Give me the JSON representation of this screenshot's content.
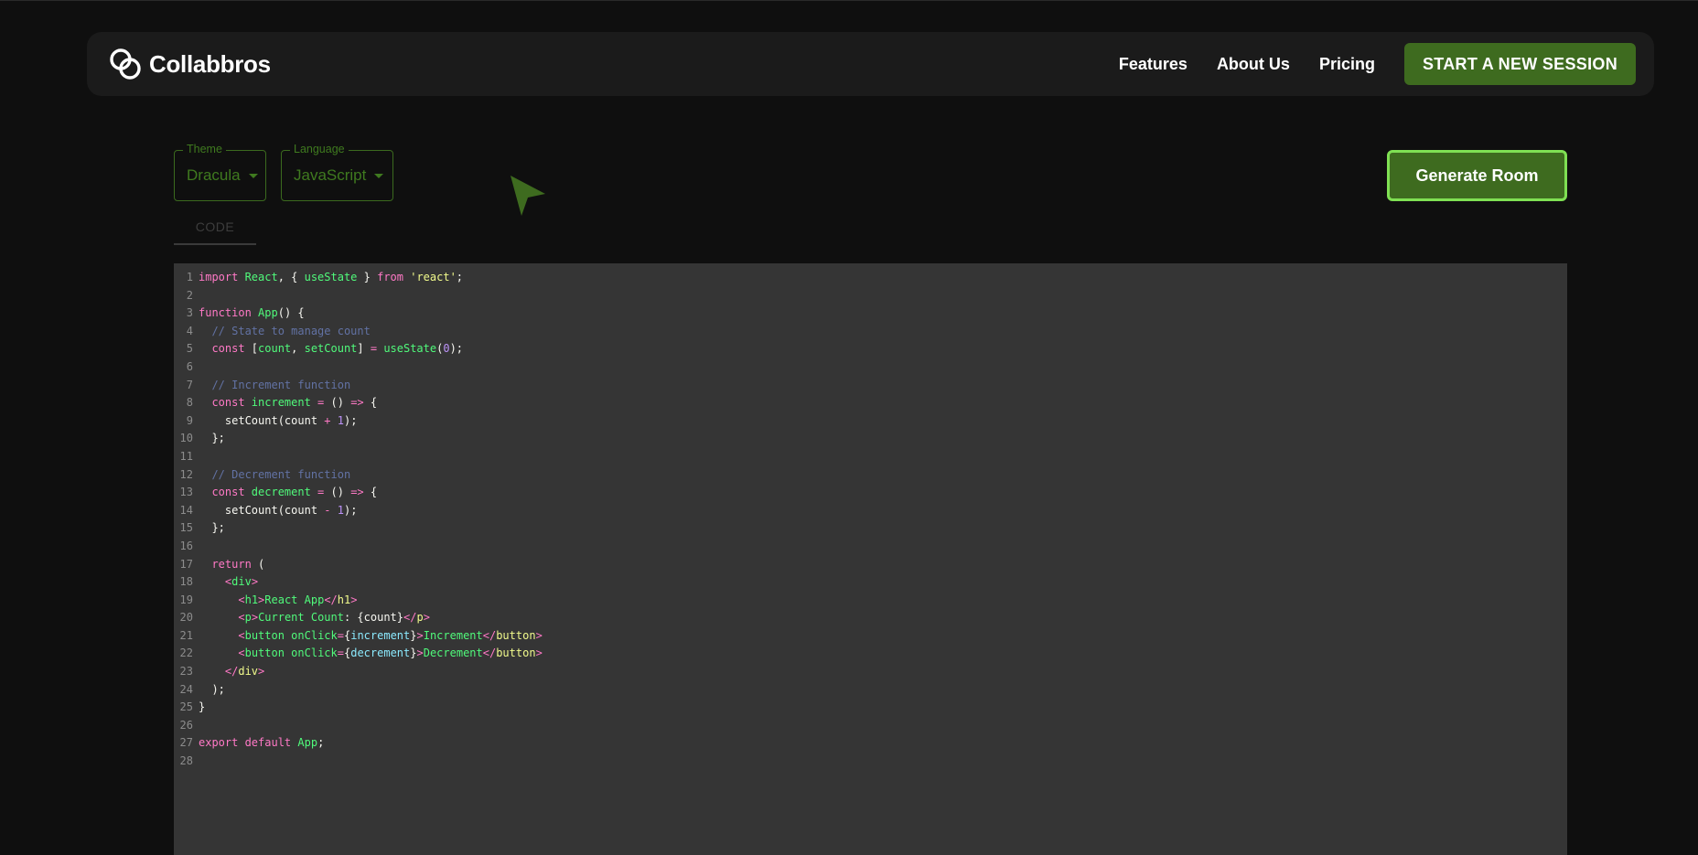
{
  "navbar": {
    "brand": "Collabbros",
    "links": [
      "Features",
      "About Us",
      "Pricing"
    ],
    "cta": "START A NEW SESSION"
  },
  "controls": {
    "theme": {
      "label": "Theme",
      "value": "Dracula"
    },
    "language": {
      "label": "Language",
      "value": "JavaScript"
    },
    "generate": "Generate Room"
  },
  "tabs": {
    "code": "CODE"
  },
  "colors": {
    "accent": "#3e6b1f",
    "accent_border": "#7fe053",
    "editor_bg": "#353535",
    "keyword": "#ff79c6",
    "function": "#50fa7b",
    "string": "#f1fa8c",
    "comment": "#6272a4",
    "number": "#bd93f9",
    "variable": "#8be9fd"
  },
  "icons": {
    "brand": "link-rings-icon",
    "cursor": "cursor-arrow-icon"
  },
  "editor": {
    "lines": [
      [
        [
          "k",
          "import "
        ],
        [
          "f",
          "React"
        ],
        [
          "t",
          ", { "
        ],
        [
          "f",
          "useState"
        ],
        [
          "t",
          " } "
        ],
        [
          "k",
          "from "
        ],
        [
          "s",
          "'react'"
        ],
        [
          "t",
          ";"
        ]
      ],
      [],
      [
        [
          "k",
          "function "
        ],
        [
          "f",
          "App"
        ],
        [
          "t",
          "() {"
        ]
      ],
      [
        [
          "c",
          "  // State to manage count"
        ]
      ],
      [
        [
          "k",
          "  const "
        ],
        [
          "t",
          "["
        ],
        [
          "f",
          "count"
        ],
        [
          "t",
          ", "
        ],
        [
          "f",
          "setCount"
        ],
        [
          "t",
          "] "
        ],
        [
          "k",
          "= "
        ],
        [
          "f",
          "useState"
        ],
        [
          "t",
          "("
        ],
        [
          "n",
          "0"
        ],
        [
          "t",
          ");"
        ]
      ],
      [],
      [
        [
          "c",
          "  // Increment function"
        ]
      ],
      [
        [
          "k",
          "  const "
        ],
        [
          "f",
          "increment "
        ],
        [
          "k",
          "= "
        ],
        [
          "t",
          "() "
        ],
        [
          "k",
          "=> "
        ],
        [
          "t",
          "{"
        ]
      ],
      [
        [
          "t",
          "    setCount(count "
        ],
        [
          "k",
          "+ "
        ],
        [
          "n",
          "1"
        ],
        [
          "t",
          ");"
        ]
      ],
      [
        [
          "t",
          "  };"
        ]
      ],
      [],
      [
        [
          "c",
          "  // Decrement function"
        ]
      ],
      [
        [
          "k",
          "  const "
        ],
        [
          "f",
          "decrement "
        ],
        [
          "k",
          "= "
        ],
        [
          "t",
          "() "
        ],
        [
          "k",
          "=> "
        ],
        [
          "t",
          "{"
        ]
      ],
      [
        [
          "t",
          "    setCount(count "
        ],
        [
          "k",
          "- "
        ],
        [
          "n",
          "1"
        ],
        [
          "t",
          ");"
        ]
      ],
      [
        [
          "t",
          "  };"
        ]
      ],
      [],
      [
        [
          "k",
          "  return "
        ],
        [
          "t",
          "("
        ]
      ],
      [
        [
          "t",
          "    "
        ],
        [
          "k",
          "<"
        ],
        [
          "f",
          "div"
        ],
        [
          "k",
          ">"
        ]
      ],
      [
        [
          "t",
          "      "
        ],
        [
          "k",
          "<"
        ],
        [
          "f",
          "h1"
        ],
        [
          "k",
          ">"
        ],
        [
          "f",
          "React App"
        ],
        [
          "k",
          "</"
        ],
        [
          "s",
          "h1"
        ],
        [
          "k",
          ">"
        ]
      ],
      [
        [
          "t",
          "      "
        ],
        [
          "k",
          "<"
        ],
        [
          "f",
          "p"
        ],
        [
          "k",
          ">"
        ],
        [
          "f",
          "Current Count"
        ],
        [
          "t",
          ": {count}"
        ],
        [
          "k",
          "</"
        ],
        [
          "s",
          "p"
        ],
        [
          "k",
          ">"
        ]
      ],
      [
        [
          "t",
          "      "
        ],
        [
          "k",
          "<"
        ],
        [
          "f",
          "button "
        ],
        [
          "f",
          "onClick"
        ],
        [
          "k",
          "="
        ],
        [
          "t",
          "{"
        ],
        [
          "v",
          "increment"
        ],
        [
          "t",
          "}"
        ],
        [
          "k",
          ">"
        ],
        [
          "f",
          "Increment"
        ],
        [
          "k",
          "</"
        ],
        [
          "s",
          "button"
        ],
        [
          "k",
          ">"
        ]
      ],
      [
        [
          "t",
          "      "
        ],
        [
          "k",
          "<"
        ],
        [
          "f",
          "button "
        ],
        [
          "f",
          "onClick"
        ],
        [
          "k",
          "="
        ],
        [
          "t",
          "{"
        ],
        [
          "v",
          "decrement"
        ],
        [
          "t",
          "}"
        ],
        [
          "k",
          ">"
        ],
        [
          "f",
          "Decrement"
        ],
        [
          "k",
          "</"
        ],
        [
          "s",
          "button"
        ],
        [
          "k",
          ">"
        ]
      ],
      [
        [
          "t",
          "    "
        ],
        [
          "k",
          "</"
        ],
        [
          "s",
          "div"
        ],
        [
          "k",
          ">"
        ]
      ],
      [
        [
          "t",
          "  );"
        ]
      ],
      [
        [
          "t",
          "}"
        ]
      ],
      [],
      [
        [
          "k",
          "export "
        ],
        [
          "k",
          "default "
        ],
        [
          "f",
          "App"
        ],
        [
          "t",
          ";"
        ]
      ],
      []
    ]
  }
}
